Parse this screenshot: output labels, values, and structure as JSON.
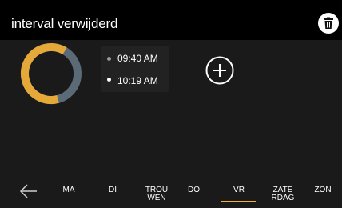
{
  "header": {
    "title": "interval verwijderd",
    "delete_icon": "trash-icon"
  },
  "interval": {
    "start_time": "09:40 AM",
    "end_time": "10:19 AM"
  },
  "actions": {
    "add_icon": "plus-circle-icon",
    "back_icon": "arrow-left-icon"
  },
  "days": [
    {
      "label": "MA",
      "active": false
    },
    {
      "label": "DI",
      "active": false
    },
    {
      "label": "TROU WEN",
      "active": false
    },
    {
      "label": "DO",
      "active": false
    },
    {
      "label": "VR",
      "active": true
    },
    {
      "label": "ZATE RDAG",
      "active": false
    },
    {
      "label": "ZON",
      "active": false
    }
  ],
  "colors": {
    "accent": "#f2b233",
    "ring_active": "#e5a93a",
    "ring_inactive": "#5a6b77"
  }
}
